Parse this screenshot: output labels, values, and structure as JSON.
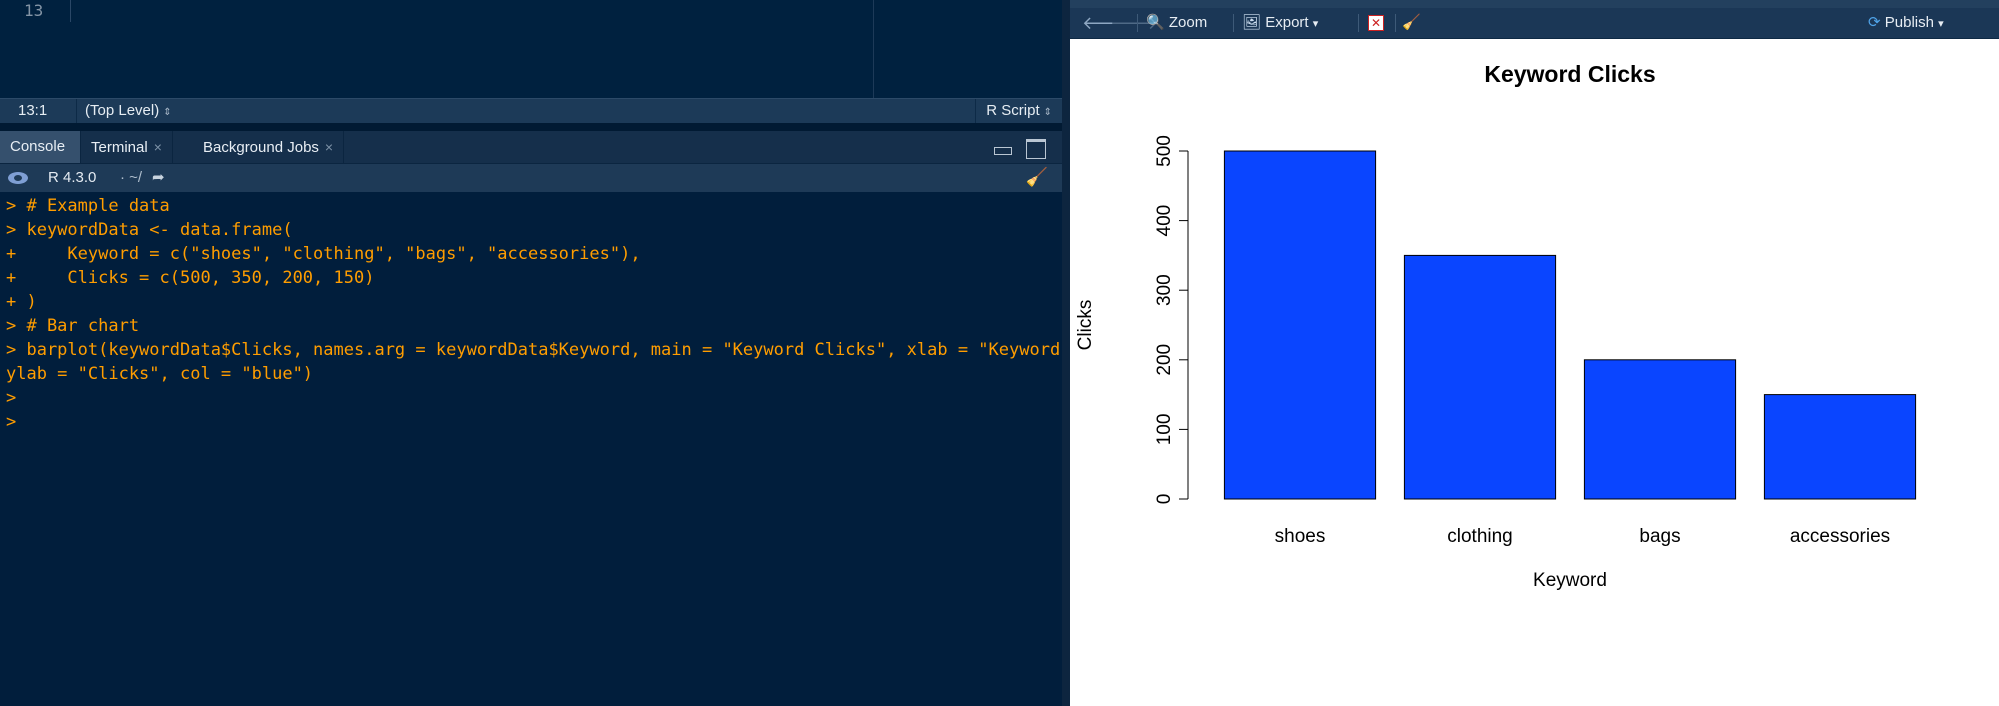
{
  "editor": {
    "line_number": "13",
    "status": {
      "cursor": "13:1",
      "scope": "(Top Level)",
      "file_type": "R Script"
    }
  },
  "console": {
    "tabs": [
      {
        "label": "Console",
        "active": true,
        "closable": false
      },
      {
        "label": "Terminal",
        "active": false,
        "closable": true
      },
      {
        "label": "Background Jobs",
        "active": false,
        "closable": true
      }
    ],
    "close_glyph": "×",
    "r_version": "R 4.3.0",
    "working_dir": "· ~/",
    "lines": [
      "> # Example data",
      "> keywordData <- data.frame(",
      "+     Keyword = c(\"shoes\", \"clothing\", \"bags\", \"accessories\"),",
      "+     Clicks = c(500, 350, 200, 150)",
      "+ )",
      "> # Bar chart",
      "> barplot(keywordData$Clicks, names.arg = keywordData$Keyword, main = \"Keyword Clicks\", xlab = \"Keyword\",",
      "ylab = \"Clicks\", col = \"blue\")",
      ">",
      ">"
    ],
    "text_color": "#ff9d00"
  },
  "plot_toolbar": {
    "zoom_label": "Zoom",
    "export_label": "Export",
    "publish_label": "Publish",
    "export_caret": "▾",
    "publish_caret": "▾"
  },
  "chart_data": {
    "type": "bar",
    "title": "Keyword Clicks",
    "xlabel": "Keyword",
    "ylabel": "Clicks",
    "categories": [
      "shoes",
      "clothing",
      "bags",
      "accessories"
    ],
    "values": [
      500,
      350,
      200,
      150
    ],
    "ylim": [
      0,
      500
    ],
    "yticks": [
      0,
      100,
      200,
      300,
      400,
      500
    ],
    "bar_color": "#0a45ff",
    "grid": false
  }
}
